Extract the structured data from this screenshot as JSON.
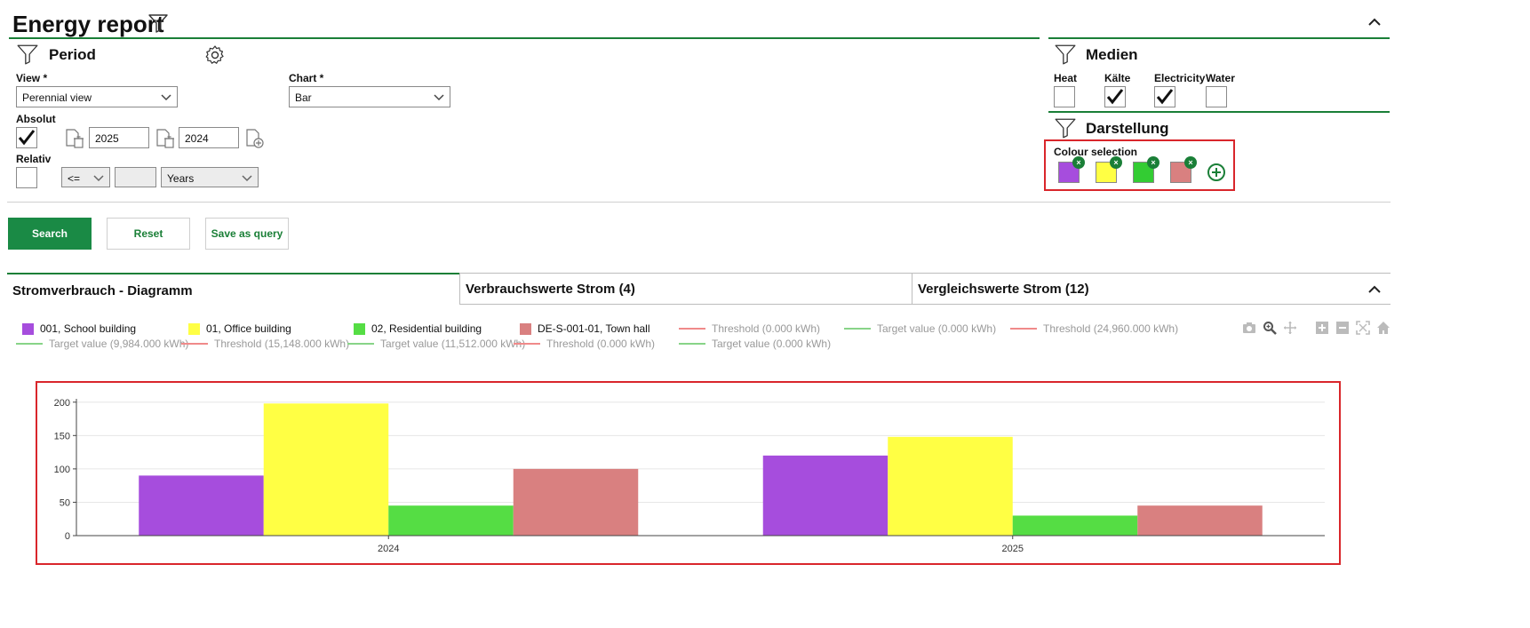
{
  "header": {
    "title": "Energy report"
  },
  "period": {
    "title": "Period",
    "view_label": "View *",
    "view_value": "Perennial view",
    "chart_label": "Chart *",
    "chart_value": "Bar",
    "absolut_label": "Absolut",
    "absolut_checked": true,
    "year_from": "2025",
    "year_to": "2024",
    "relativ_label": "Relativ",
    "relativ_checked": false,
    "operator_value": "<=",
    "number_value": "",
    "unit_value": "Years"
  },
  "medien": {
    "title": "Medien",
    "items": [
      {
        "label": "Heat",
        "checked": false
      },
      {
        "label": "Kälte",
        "checked": true
      },
      {
        "label": "Electricity",
        "checked": true
      },
      {
        "label": "Water",
        "checked": false
      }
    ]
  },
  "darstellung": {
    "title": "Darstellung",
    "colour_label": "Colour selection",
    "colours": [
      "#a64ddd",
      "#ffff44",
      "#33cc33",
      "#d98080"
    ]
  },
  "actions": {
    "search": "Search",
    "reset": "Reset",
    "save_query": "Save as query"
  },
  "tabs": [
    {
      "label": "Stromverbrauch - Diagramm",
      "active": true
    },
    {
      "label": "Verbrauchswerte Strom (4)",
      "active": false
    },
    {
      "label": "Vergleichswerte Strom (12)",
      "active": false
    }
  ],
  "legend": {
    "row1": [
      {
        "kind": "box",
        "color": "#a64ddd",
        "label": "001, School building",
        "dim": false
      },
      {
        "kind": "box",
        "color": "#ffff44",
        "label": "01, Office building",
        "dim": false
      },
      {
        "kind": "box",
        "color": "#55dd44",
        "label": "02, Residential building",
        "dim": false
      },
      {
        "kind": "box",
        "color": "#d98080",
        "label": "DE-S-001-01, Town hall",
        "dim": false
      },
      {
        "kind": "line",
        "color": "#f08a8a",
        "label": "Threshold (0.000 kWh)",
        "dim": true
      },
      {
        "kind": "line",
        "color": "#88d488",
        "label": "Target value (0.000 kWh)",
        "dim": true
      },
      {
        "kind": "line",
        "color": "#f08a8a",
        "label": "Threshold (24,960.000 kWh)",
        "dim": true
      }
    ],
    "row2": [
      {
        "kind": "line",
        "color": "#88d488",
        "label": "Target value (9,984.000 kWh)",
        "dim": true
      },
      {
        "kind": "line",
        "color": "#f08a8a",
        "label": "Threshold (15,148.000 kWh)",
        "dim": true
      },
      {
        "kind": "line",
        "color": "#88d488",
        "label": "Target value (11,512.000 kWh)",
        "dim": true
      },
      {
        "kind": "line",
        "color": "#f08a8a",
        "label": "Threshold (0.000 kWh)",
        "dim": true
      },
      {
        "kind": "line",
        "color": "#88d488",
        "label": "Target value (0.000 kWh)",
        "dim": true
      }
    ]
  },
  "toolbar_icons": [
    "camera-icon",
    "zoom-icon",
    "pan-icon",
    "zoom-in-icon",
    "zoom-out-icon",
    "autoscale-icon",
    "reset-axes-icon"
  ],
  "chart_data": {
    "type": "bar",
    "categories": [
      "2024",
      "2025"
    ],
    "series": [
      {
        "name": "001, School building",
        "color": "#a64ddd",
        "values": [
          90,
          120
        ]
      },
      {
        "name": "01, Office building",
        "color": "#ffff44",
        "values": [
          198,
          148
        ]
      },
      {
        "name": "02, Residential building",
        "color": "#55dd44",
        "values": [
          45,
          30
        ]
      },
      {
        "name": "DE-S-001-01, Town hall",
        "color": "#d98080",
        "values": [
          100,
          45
        ]
      }
    ],
    "yticks": [
      0,
      50,
      100,
      150,
      200
    ],
    "ylim": [
      0,
      205
    ],
    "grid": true,
    "xlabel": "",
    "ylabel": "",
    "title": ""
  }
}
